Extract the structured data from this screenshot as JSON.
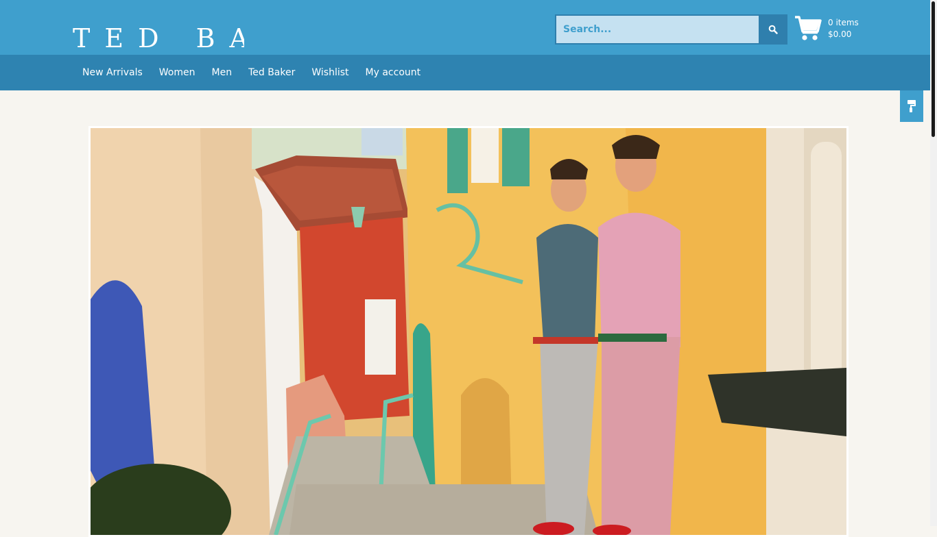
{
  "header": {
    "logo_text": "TED BAKE",
    "search": {
      "placeholder": "Search...",
      "value": ""
    },
    "search_icon": "search-icon",
    "cart": {
      "icon": "cart-icon",
      "items": "0 items",
      "total": "$0.00"
    }
  },
  "nav": {
    "items": [
      {
        "label": "New Arrivals"
      },
      {
        "label": "Women"
      },
      {
        "label": "Men"
      },
      {
        "label": "Ted Baker"
      },
      {
        "label": "Wishlist"
      },
      {
        "label": "My account"
      }
    ]
  },
  "side_tab": {
    "icon": "paint-roller-icon"
  },
  "hero": {
    "description_icon": "hero-photo"
  },
  "colors": {
    "header_bg": "#3f9fcd",
    "nav_bg": "#2e83b1",
    "page_bg": "#f7f5f0",
    "search_bg": "#c5e1f1",
    "search_button_bg": "#2f7fad"
  }
}
